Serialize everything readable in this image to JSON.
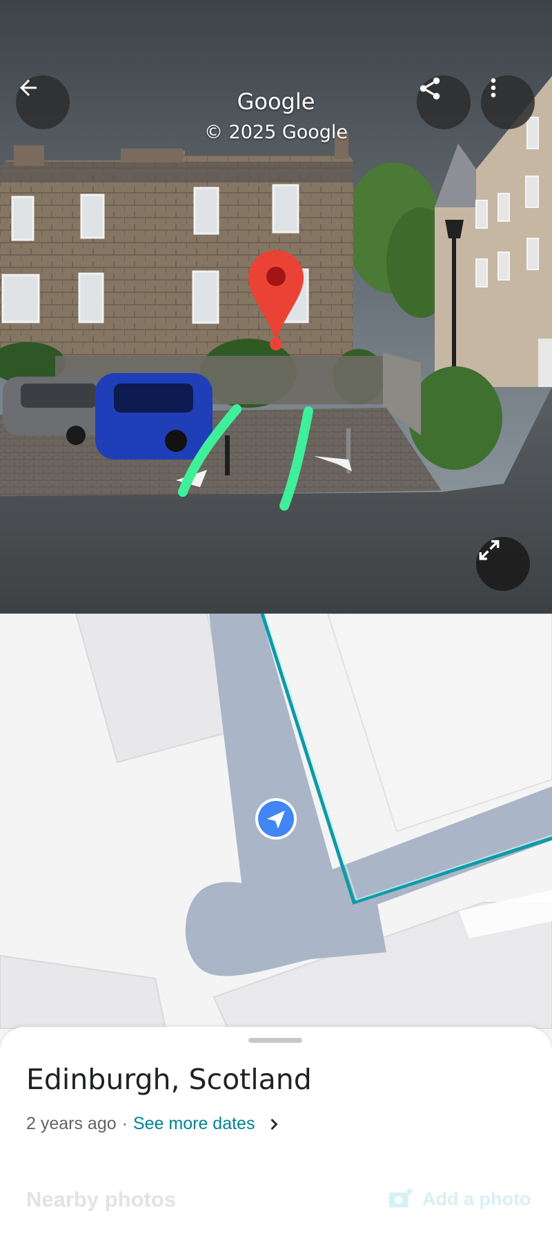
{
  "header": {
    "brand": "Google",
    "copyright": "© 2025 Google",
    "back_icon": "arrow-left-icon",
    "share_icon": "share-icon",
    "more_icon": "more-vert-icon",
    "expand_icon": "expand-icon"
  },
  "sheet": {
    "place": "Edinburgh, Scotland",
    "age": "2 years ago",
    "separator": "·",
    "see_more": "See more dates",
    "nearby": "Nearby photos",
    "add_photo": "Add a photo"
  },
  "colors": {
    "route": "#0e9aa7",
    "pin": "#ea4335",
    "location": "#4285f4",
    "road": "#aab6c7",
    "highlight": "#3ff09a"
  }
}
